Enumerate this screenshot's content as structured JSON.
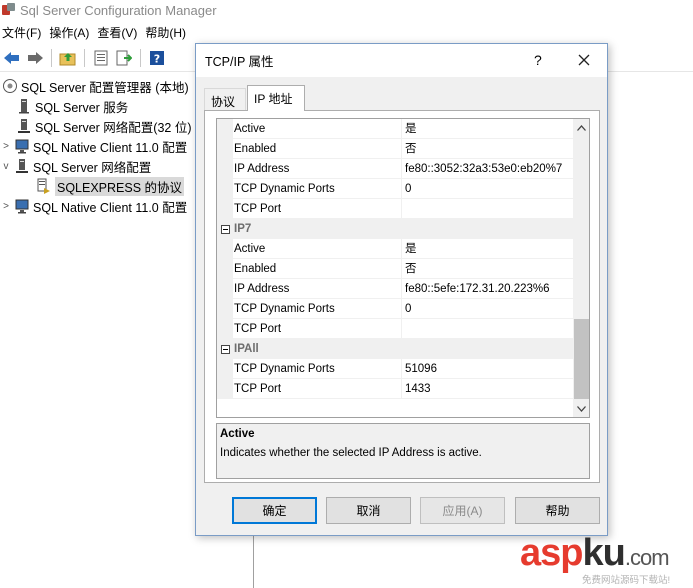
{
  "window": {
    "title": "Sql Server Configuration Manager"
  },
  "menu": [
    "文件(F)",
    "操作(A)",
    "查看(V)",
    "帮助(H)"
  ],
  "tree": {
    "items": [
      {
        "label": "SQL Server 配置管理器 (本地)",
        "icon": "server-manager-icon",
        "expander": ""
      },
      {
        "label": "SQL Server 服务",
        "icon": "services-icon",
        "expander": ""
      },
      {
        "label": "SQL Server 网络配置(32 位)",
        "icon": "network-config-icon",
        "expander": ">"
      },
      {
        "label": "SQL Native Client 11.0 配置",
        "icon": "client-config-icon",
        "expander": ">"
      },
      {
        "label": "SQL Server 网络配置",
        "icon": "network-config-icon",
        "expander": "v"
      },
      {
        "label": "SQLEXPRESS 的协议",
        "icon": "protocols-icon",
        "expander": ""
      },
      {
        "label": "SQL Native Client 11.0 配置",
        "icon": "client-config-icon",
        "expander": ">"
      }
    ]
  },
  "dialog": {
    "title": "TCP/IP 属性",
    "help_glyph": "?",
    "tabs": [
      "协议",
      "IP 地址"
    ],
    "active_tab": 1,
    "grid": {
      "rows": [
        {
          "type": "prop",
          "name": "Active",
          "value": "是"
        },
        {
          "type": "prop",
          "name": "Enabled",
          "value": "否"
        },
        {
          "type": "prop",
          "name": "IP Address",
          "value": "fe80::3052:32a3:53e0:eb20%7"
        },
        {
          "type": "prop",
          "name": "TCP Dynamic Ports",
          "value": "0"
        },
        {
          "type": "prop",
          "name": "TCP Port",
          "value": ""
        },
        {
          "type": "category",
          "name": "IP7"
        },
        {
          "type": "prop",
          "name": "Active",
          "value": "是"
        },
        {
          "type": "prop",
          "name": "Enabled",
          "value": "否"
        },
        {
          "type": "prop",
          "name": "IP Address",
          "value": "fe80::5efe:172.31.20.223%6"
        },
        {
          "type": "prop",
          "name": "TCP Dynamic Ports",
          "value": "0"
        },
        {
          "type": "prop",
          "name": "TCP Port",
          "value": ""
        },
        {
          "type": "category",
          "name": "IPAll"
        },
        {
          "type": "prop",
          "name": "TCP Dynamic Ports",
          "value": "51096"
        },
        {
          "type": "prop",
          "name": "TCP Port",
          "value": "1433"
        }
      ]
    },
    "description": {
      "title": "Active",
      "text": "Indicates whether the selected IP Address is active."
    },
    "buttons": {
      "ok": "确定",
      "cancel": "取消",
      "apply": "应用(A)",
      "help": "帮助"
    }
  },
  "watermark": {
    "text_a": "asp",
    "text_b": "ku",
    "suffix": ".com",
    "subtitle": "免费网站源码下载站!"
  },
  "colors": {
    "accent": "#0078d7",
    "selected_tree": "#d9d9d9",
    "category_text": "#6d6d6d",
    "watermark_red": "#e63b2e"
  }
}
